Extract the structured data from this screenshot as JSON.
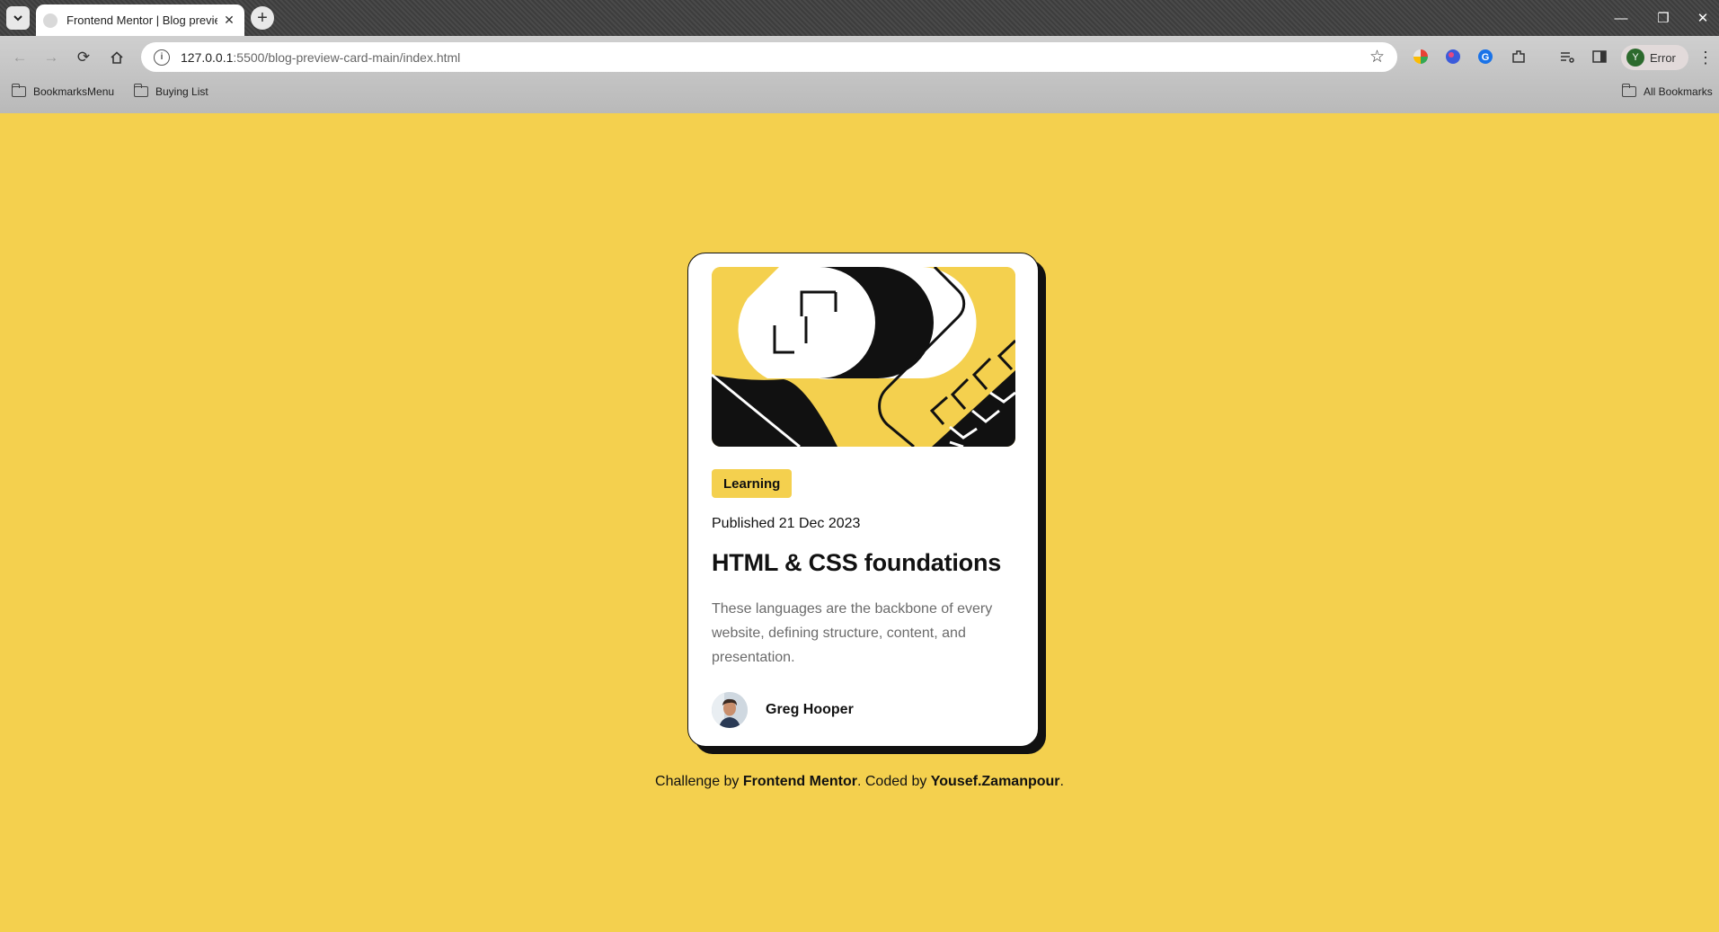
{
  "browser": {
    "tab_title": "Frontend Mentor | Blog preview card",
    "tab_close": "✕",
    "new_tab": "+",
    "url_host": "127.0.0.1",
    "url_path": ":5500/blog-preview-card-main/index.html",
    "profile_initial": "Y",
    "profile_status": "Error",
    "bookmarks": [
      "BookmarksMenu",
      "Buying List"
    ],
    "all_bookmarks": "All Bookmarks"
  },
  "card": {
    "tag": "Learning",
    "published": "Published 21 Dec 2023",
    "title": "HTML & CSS foundations",
    "description": "These languages are the backbone of every website, defining structure, content, and presentation.",
    "author": "Greg Hooper"
  },
  "attribution": {
    "prefix": "Challenge by ",
    "link1": "Frontend Mentor",
    "middle": ". Coded by ",
    "link2": "Yousef.Zamanpour",
    "suffix": "."
  },
  "colors": {
    "background": "#f4d04e",
    "text": "#111111",
    "muted": "#6b6b6b"
  }
}
